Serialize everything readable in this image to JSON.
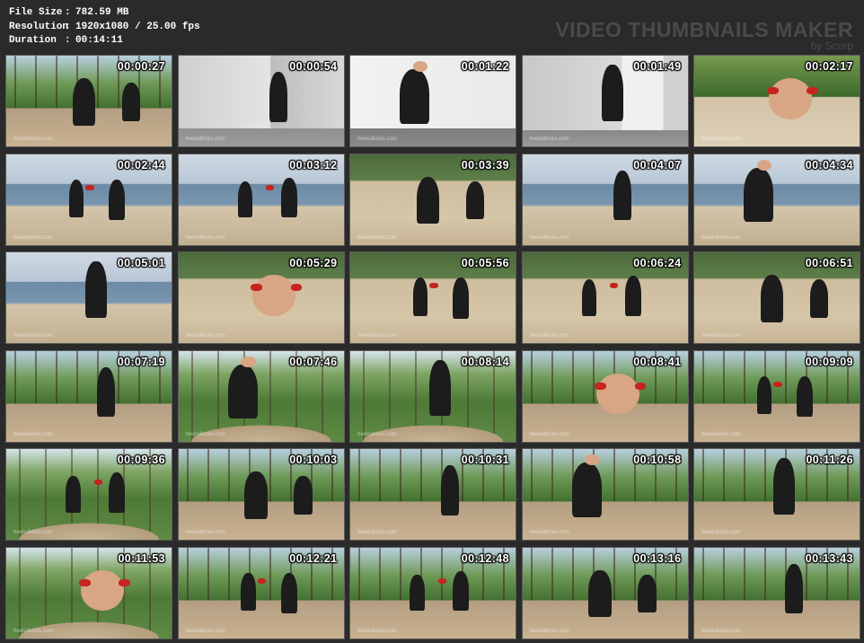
{
  "info": {
    "file_size_label": "File Size",
    "file_size_value": "782.59 MB",
    "resolution_label": "Resolution",
    "resolution_value": "1920x1080 / 25.00 fps",
    "duration_label": "Duration",
    "duration_value": "00:14:11"
  },
  "brand": {
    "title": "VIDEO THUMBNAILS MAKER",
    "subtitle": "by Scorp"
  },
  "watermark": "heelsdkicks.com",
  "thumbnails": [
    {
      "time": "00:00:27",
      "scene": "forest"
    },
    {
      "time": "00:00:54",
      "scene": "wall"
    },
    {
      "time": "00:01:22",
      "scene": "building"
    },
    {
      "time": "00:01:49",
      "scene": "door"
    },
    {
      "time": "00:02:17",
      "scene": "garden"
    },
    {
      "time": "00:02:44",
      "scene": "beachsea"
    },
    {
      "time": "00:03:12",
      "scene": "beachsea"
    },
    {
      "time": "00:03:39",
      "scene": "beachsand"
    },
    {
      "time": "00:04:07",
      "scene": "beachsea"
    },
    {
      "time": "00:04:34",
      "scene": "beachsea"
    },
    {
      "time": "00:05:01",
      "scene": "beachsea"
    },
    {
      "time": "00:05:29",
      "scene": "beachsand"
    },
    {
      "time": "00:05:56",
      "scene": "beachsand"
    },
    {
      "time": "00:06:24",
      "scene": "beachsand"
    },
    {
      "time": "00:06:51",
      "scene": "beachsand"
    },
    {
      "time": "00:07:19",
      "scene": "forest"
    },
    {
      "time": "00:07:46",
      "scene": "forest2"
    },
    {
      "time": "00:08:14",
      "scene": "forest2"
    },
    {
      "time": "00:08:41",
      "scene": "forest"
    },
    {
      "time": "00:09:09",
      "scene": "forest"
    },
    {
      "time": "00:09:36",
      "scene": "forest2"
    },
    {
      "time": "00:10:03",
      "scene": "forest"
    },
    {
      "time": "00:10:31",
      "scene": "forest"
    },
    {
      "time": "00:10:58",
      "scene": "forest"
    },
    {
      "time": "00:11:26",
      "scene": "forest"
    },
    {
      "time": "00:11:53",
      "scene": "forest2"
    },
    {
      "time": "00:12:21",
      "scene": "forest"
    },
    {
      "time": "00:12:48",
      "scene": "forest"
    },
    {
      "time": "00:13:16",
      "scene": "forest"
    },
    {
      "time": "00:13:43",
      "scene": "forest"
    }
  ]
}
